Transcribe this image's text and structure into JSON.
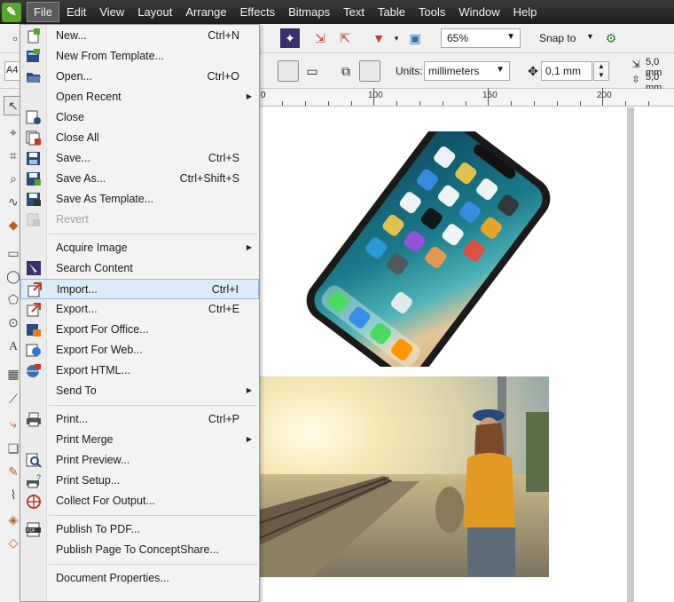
{
  "menubar": {
    "items": [
      "File",
      "Edit",
      "View",
      "Layout",
      "Arrange",
      "Effects",
      "Bitmaps",
      "Text",
      "Table",
      "Tools",
      "Window",
      "Help"
    ],
    "active": "File"
  },
  "toolbar": {
    "zoom": "65%",
    "snap_to": "Snap to",
    "page_size": "A4",
    "units_label": "Units:",
    "units_value": "millimeters",
    "nudge": "0,1 mm",
    "dup_x": "5,0 mm",
    "dup_y": "5,0 mm"
  },
  "ruler": {
    "labels": [
      "100",
      "150",
      "200"
    ]
  },
  "file_menu": {
    "items": [
      {
        "label": "New...",
        "shortcut": "Ctrl+N",
        "icon": "new-document-icon"
      },
      {
        "label": "New From Template...",
        "shortcut": "",
        "icon": "template-icon"
      },
      {
        "label": "Open...",
        "shortcut": "Ctrl+O",
        "icon": "open-folder-icon"
      },
      {
        "label": "Open Recent",
        "shortcut": "",
        "submenu": true
      },
      {
        "label": "Close",
        "shortcut": "",
        "icon": "close-document-icon"
      },
      {
        "label": "Close All",
        "shortcut": "",
        "icon": "close-all-icon"
      },
      {
        "label": "Save...",
        "shortcut": "Ctrl+S",
        "icon": "save-icon"
      },
      {
        "label": "Save As...",
        "shortcut": "Ctrl+Shift+S",
        "icon": "save-as-icon"
      },
      {
        "label": "Save As Template...",
        "shortcut": "",
        "icon": "save-template-icon"
      },
      {
        "label": "Revert",
        "shortcut": "",
        "icon": "revert-icon",
        "disabled": true
      },
      {
        "label": "Acquire Image",
        "shortcut": "",
        "submenu": true
      },
      {
        "label": "Search Content",
        "shortcut": "",
        "icon": "search-content-icon"
      },
      {
        "label": "Import...",
        "shortcut": "Ctrl+I",
        "icon": "import-icon",
        "hover": true
      },
      {
        "label": "Export...",
        "shortcut": "Ctrl+E",
        "icon": "export-icon"
      },
      {
        "label": "Export For Office...",
        "shortcut": "",
        "icon": "export-office-icon"
      },
      {
        "label": "Export For Web...",
        "shortcut": "",
        "icon": "export-web-icon"
      },
      {
        "label": "Export HTML...",
        "shortcut": "",
        "icon": "export-html-icon"
      },
      {
        "label": "Send To",
        "shortcut": "",
        "submenu": true
      },
      {
        "label": "Print...",
        "shortcut": "Ctrl+P",
        "icon": "print-icon"
      },
      {
        "label": "Print Merge",
        "shortcut": "",
        "submenu": true
      },
      {
        "label": "Print Preview...",
        "shortcut": "",
        "icon": "print-preview-icon"
      },
      {
        "label": "Print Setup...",
        "shortcut": "",
        "icon": "print-setup-icon"
      },
      {
        "label": "Collect For Output...",
        "shortcut": "",
        "icon": "collect-output-icon"
      },
      {
        "label": "Publish To PDF...",
        "shortcut": "",
        "icon": "pdf-icon"
      },
      {
        "label": "Publish Page To ConceptShare...",
        "shortcut": "",
        "icon": ""
      },
      {
        "label": "Document Properties...",
        "shortcut": "",
        "icon": ""
      }
    ]
  },
  "colors": {
    "menubar_bg": "#2a2a2a",
    "menu_bg": "#f3f3f3",
    "hover_bg": "#ddeaf7",
    "hover_border": "#93b8e0",
    "accent_green": "#5aa52a"
  }
}
